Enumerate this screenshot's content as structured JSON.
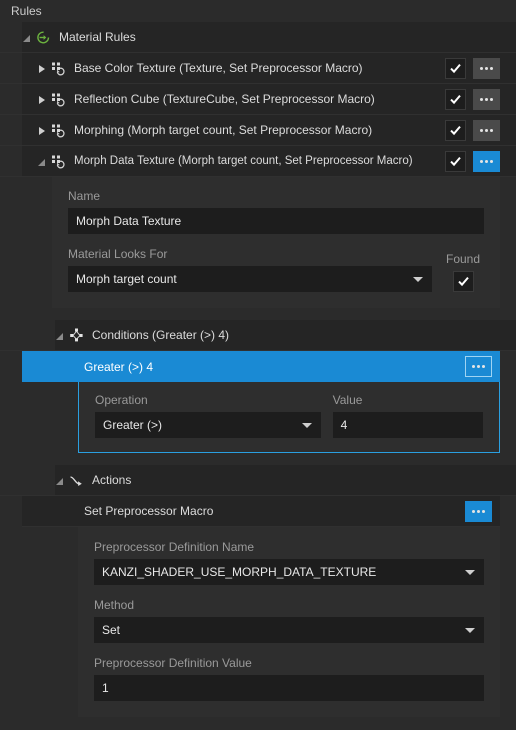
{
  "panel": {
    "title": "Rules"
  },
  "tree": {
    "root": {
      "label": "Material Rules",
      "icon": "material-rules-arrow-icon",
      "expanded": true
    },
    "rules": [
      {
        "label": "Base Color Texture (Texture, Set Preprocessor Macro)",
        "icon": "rule-icon",
        "expanded": false,
        "enabled_check": "✓",
        "menu": "•••",
        "menu_active": false
      },
      {
        "label": "Reflection Cube (TextureCube, Set Preprocessor Macro)",
        "icon": "rule-icon",
        "expanded": false,
        "enabled_check": "✓",
        "menu": "•••",
        "menu_active": false
      },
      {
        "label": "Morphing (Morph target count, Set Preprocessor Macro)",
        "icon": "rule-icon",
        "expanded": false,
        "enabled_check": "✓",
        "menu": "•••",
        "menu_active": false
      },
      {
        "label": "Morph Data Texture (Morph target count, Set Preprocessor Macro)",
        "icon": "rule-icon",
        "expanded": true,
        "enabled_check": "✓",
        "menu": "•••",
        "menu_active": true
      }
    ]
  },
  "rule_editor": {
    "name": {
      "label": "Name",
      "value": "Morph Data Texture"
    },
    "material_looks_for": {
      "label": "Material Looks For",
      "value": "Morph target count"
    },
    "found": {
      "label": "Found",
      "checked": true
    }
  },
  "conditions": {
    "header": {
      "label": "Conditions (Greater (>) 4)",
      "icon": "conditions-node-icon",
      "expanded": true
    },
    "selected_item": {
      "label": "Greater (>) 4",
      "menu": "•••"
    },
    "operation": {
      "label": "Operation",
      "value": "Greater (>)"
    },
    "value": {
      "label": "Value",
      "value": "4"
    }
  },
  "actions": {
    "header": {
      "label": "Actions",
      "icon": "actions-arrow-icon",
      "expanded": true
    },
    "item": {
      "label": "Set Preprocessor Macro",
      "menu": "•••",
      "menu_active": true
    },
    "preprocessor_definition_name": {
      "label": "Preprocessor Definition Name",
      "value": "KANZI_SHADER_USE_MORPH_DATA_TEXTURE"
    },
    "method": {
      "label": "Method",
      "value": "Set"
    },
    "preprocessor_definition_value": {
      "label": "Preprocessor Definition Value",
      "value": "1"
    }
  },
  "colors": {
    "accent": "#1a8ad4",
    "accent_border": "#2a9fe0",
    "panel_bg": "#2b2b2b",
    "row_bg": "#252525",
    "editor_bg": "#2e2e2e",
    "input_bg": "#1d1d1d",
    "icon_green": "#6cb33f",
    "text": "#dcdcdc",
    "label_text": "#9a9a9a"
  }
}
